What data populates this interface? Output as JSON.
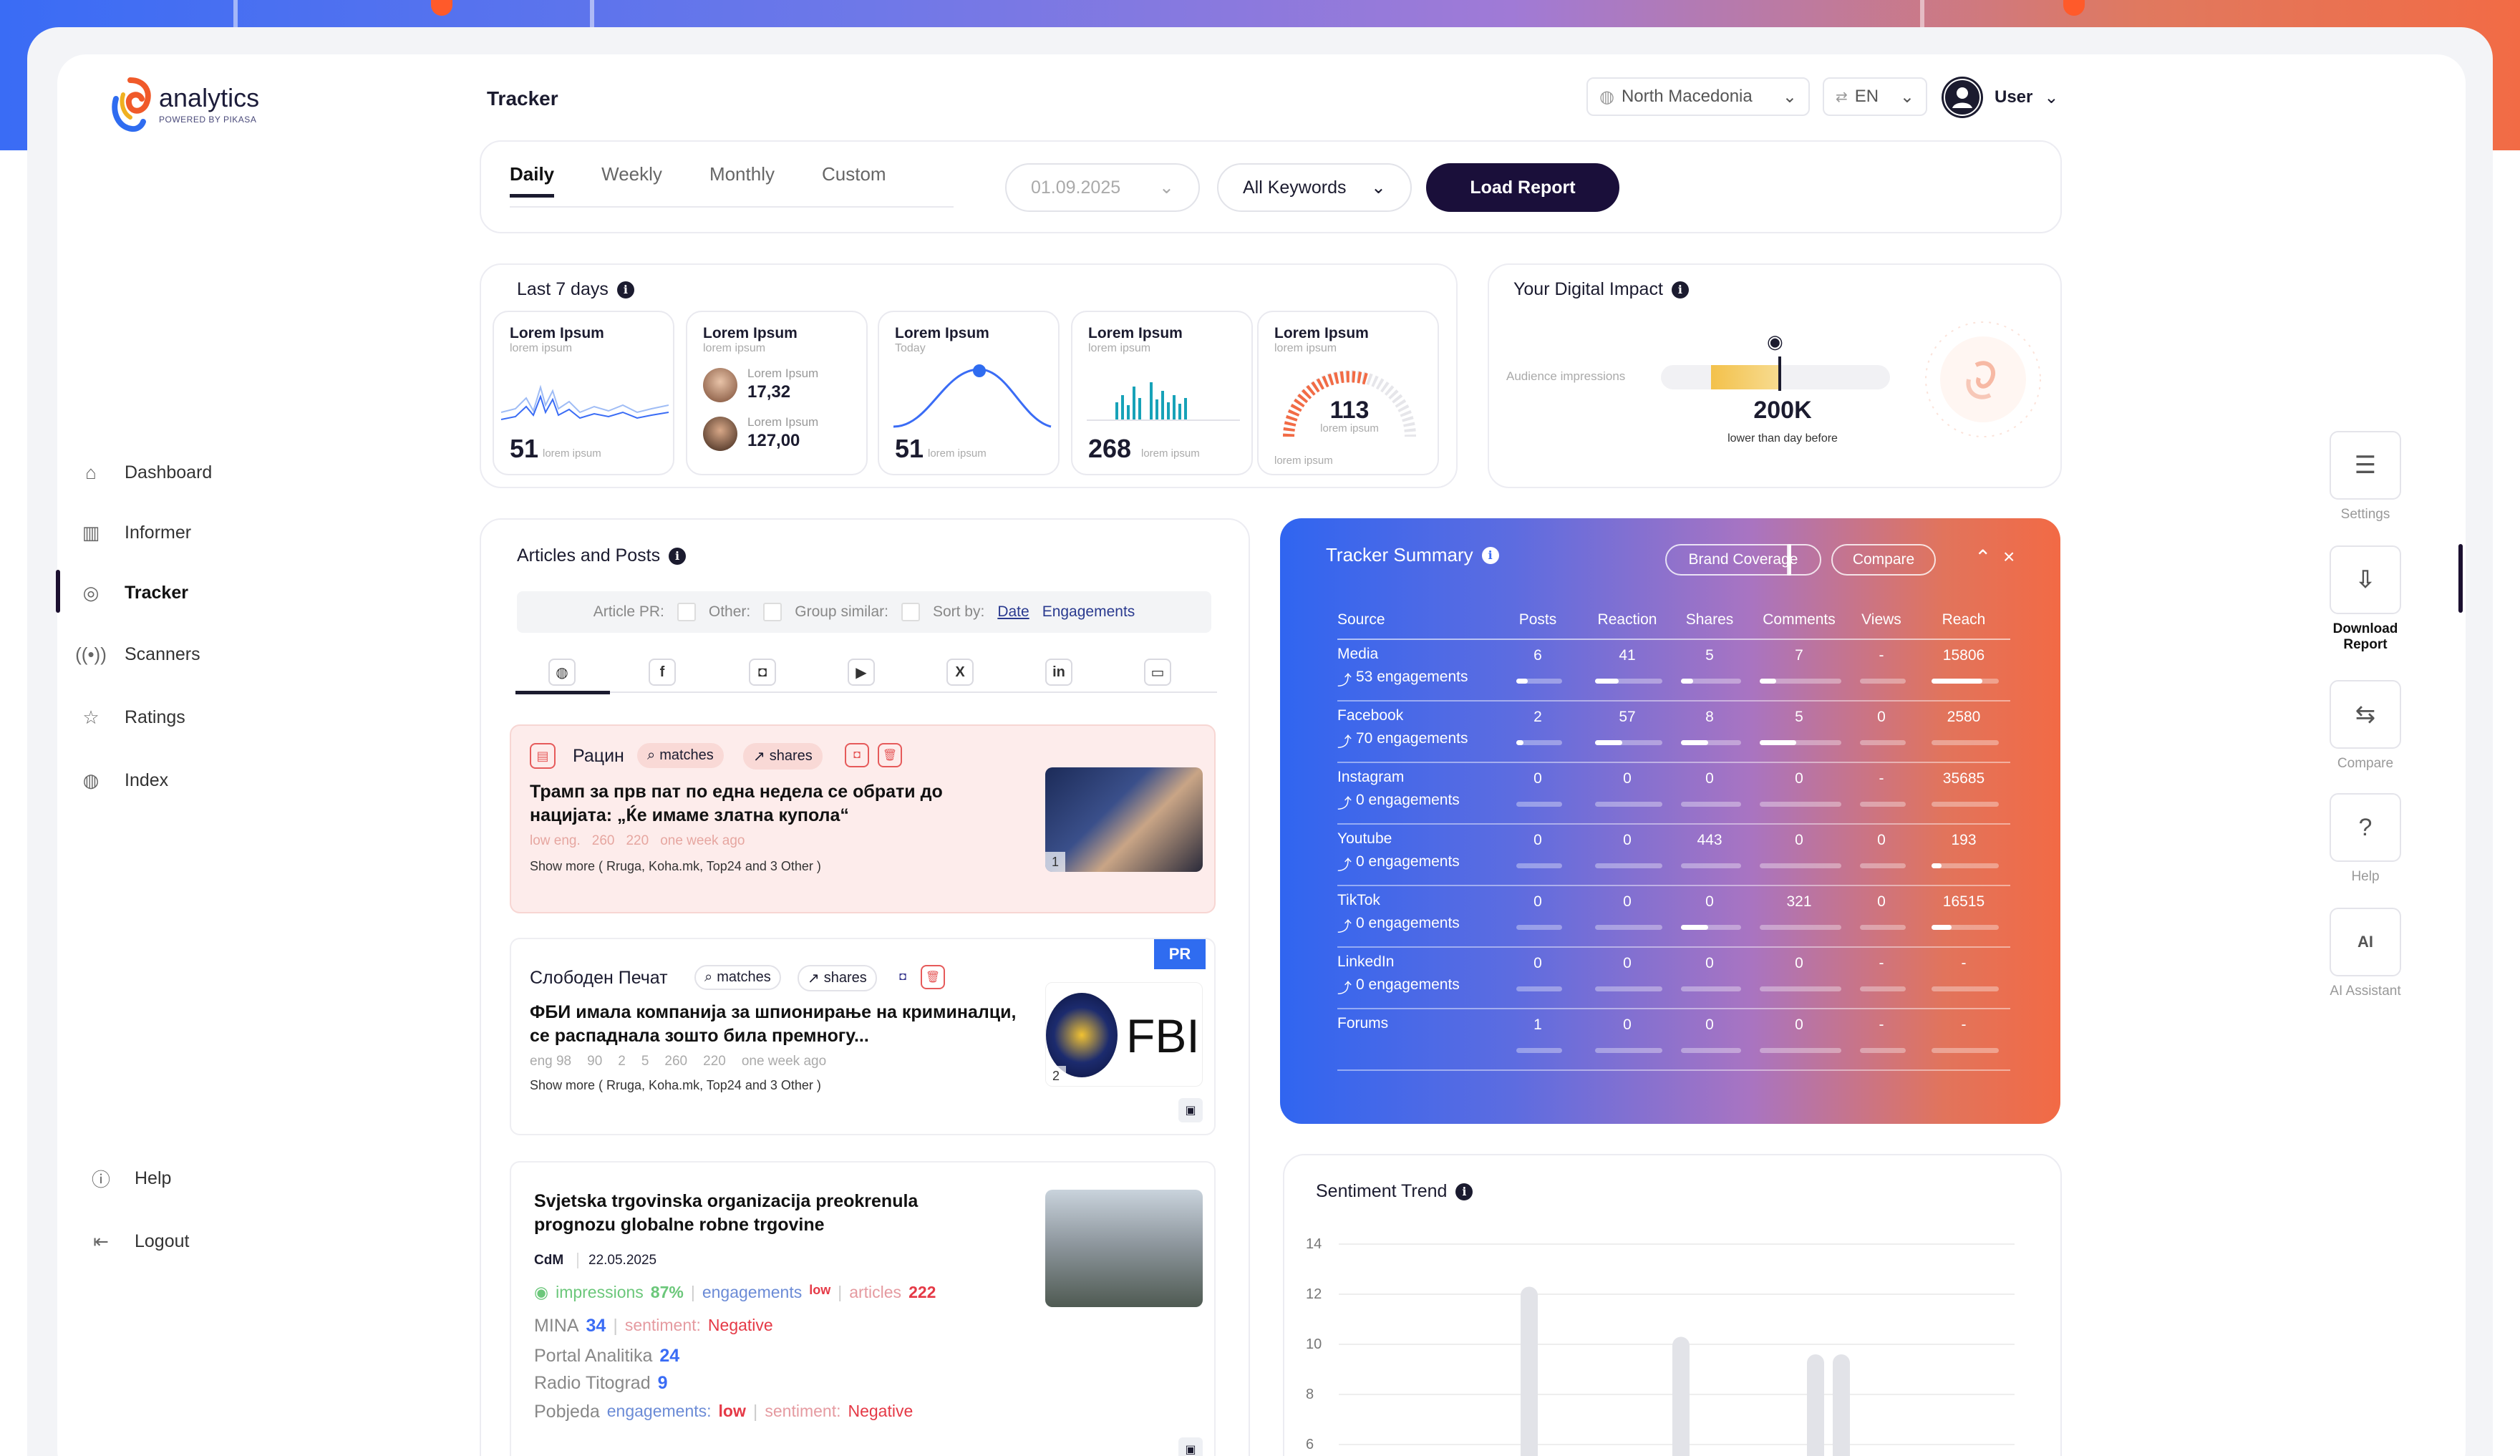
{
  "brand": {
    "name": "analytics",
    "powered_by": "POWERED BY PIKASA"
  },
  "page_title": "Tracker",
  "header": {
    "country": "North Macedonia",
    "language": "EN",
    "user": "User"
  },
  "sidebar": {
    "items": [
      {
        "label": "Dashboard",
        "icon": "home-icon"
      },
      {
        "label": "Informer",
        "icon": "bars-icon"
      },
      {
        "label": "Tracker",
        "icon": "fingerprint-icon"
      },
      {
        "label": "Scanners",
        "icon": "radar-icon"
      },
      {
        "label": "Ratings",
        "icon": "star-icon"
      },
      {
        "label": "Index",
        "icon": "globe-icon"
      }
    ],
    "help": "Help",
    "logout": "Logout"
  },
  "filters": {
    "tabs": [
      "Daily",
      "Weekly",
      "Monthly",
      "Custom"
    ],
    "date": "01.09.2025",
    "keywords": "All Keywords",
    "load_button": "Load Report"
  },
  "last7": {
    "title": "Last 7 days",
    "cards": [
      {
        "title": "Lorem Ipsum",
        "sub": "lorem ipsum",
        "value": "51",
        "value_sub": "lorem ipsum"
      },
      {
        "title": "Lorem Ipsum",
        "sub": "lorem ipsum",
        "person1_label": "Lorem Ipsum",
        "person1_value": "17,32",
        "person2_label": "Lorem Ipsum",
        "person2_value": "127,00"
      },
      {
        "title": "Lorem Ipsum",
        "sub": "Today",
        "value": "51",
        "value_sub": "lorem ipsum"
      },
      {
        "title": "Lorem Ipsum",
        "sub": "lorem ipsum",
        "value": "268",
        "value_sub": "lorem ipsum"
      },
      {
        "title": "Lorem Ipsum",
        "sub": "lorem ipsum",
        "gauge_value": "113",
        "gauge_sub": "lorem ipsum",
        "value_sub": "lorem ipsum"
      }
    ]
  },
  "impact": {
    "title": "Your Digital Impact",
    "label": "Audience impressions",
    "value": "200K",
    "note": "lower than day before"
  },
  "articles": {
    "title": "Articles and Posts",
    "filter": {
      "article_pr": "Article PR:",
      "other": "Other:",
      "group_similar": "Group similar:",
      "sort_by": "Sort by:",
      "sort_date": "Date",
      "sort_eng": "Engagements"
    },
    "social": [
      "globe-icon",
      "facebook-icon",
      "instagram-icon",
      "youtube-icon",
      "x-icon",
      "linkedin-icon",
      "comment-icon"
    ],
    "items": [
      {
        "source": "Рацин",
        "matches": "matches",
        "shares": "shares",
        "title": "Трамп за прв пат по една недела се обрати до нацијата: „Ќе имаме златна купола“",
        "eng": "low eng.",
        "e1": "260",
        "e2": "220",
        "time": "one week ago",
        "show_more": "Show more ( Rruga, Koha.mk, Top24 and 3 Other )",
        "count": "1"
      },
      {
        "source": "Слободен Печат",
        "matches": "matches",
        "shares": "shares",
        "badge": "PR",
        "title": "ФБИ имала компанија за шпионирање на криминалци, се распаднала зошто била премногу...",
        "eng": "eng 98",
        "likes": "90",
        "comments": "2",
        "reshares": "5",
        "e1": "260",
        "e2": "220",
        "time": "one week ago",
        "show_more": "Show more ( Rruga, Koha.mk, Top24 and 3 Other )",
        "count": "2",
        "thumb_text": "FBI"
      },
      {
        "title": "Svjetska trgovinska organizacija preokrenula prognozu globalne robne trgovine",
        "source": "CdM",
        "date": "22.05.2025",
        "impressions": "impressions",
        "impressions_val": "87%",
        "engagements": "engagements",
        "engagements_val": "low",
        "articles": "articles",
        "articles_val": "222",
        "outlets": [
          {
            "name": "MINA",
            "val": "34",
            "sent_label": "sentiment:",
            "sent": "Negative"
          },
          {
            "name": "Portal Analitika",
            "val": "24"
          },
          {
            "name": "Radio Titograd",
            "val": "9"
          },
          {
            "name": "Pobjeda",
            "eng_label": "engagements:",
            "eng": "low",
            "sent_label": "sentiment:",
            "sent": "Negative"
          }
        ]
      }
    ]
  },
  "summary": {
    "title": "Tracker Summary",
    "brand_coverage": "Brand Coverage",
    "compare": "Compare",
    "columns": [
      "Source",
      "Posts",
      "Reaction",
      "Shares",
      "Comments",
      "Views",
      "Reach"
    ],
    "rows": [
      {
        "source": "Media",
        "eng": "53 engagements",
        "values": [
          "6",
          "41",
          "5",
          "7",
          "-",
          "15806"
        ],
        "fills": [
          0.25,
          0.35,
          0.2,
          0.2,
          0,
          0.75
        ]
      },
      {
        "source": "Facebook",
        "eng": "70 engagements",
        "values": [
          "2",
          "57",
          "8",
          "5",
          "0",
          "2580"
        ],
        "fills": [
          0.15,
          0.4,
          0.45,
          0.45,
          0,
          0.0
        ]
      },
      {
        "source": "Instagram",
        "eng": "0 engagements",
        "values": [
          "0",
          "0",
          "0",
          "0",
          "-",
          "35685"
        ],
        "fills": [
          0,
          0,
          0,
          0,
          0,
          0
        ]
      },
      {
        "source": "Youtube",
        "eng": "0 engagements",
        "values": [
          "0",
          "0",
          "443",
          "0",
          "0",
          "193"
        ],
        "fills": [
          0,
          0,
          0,
          0,
          0,
          0.15
        ]
      },
      {
        "source": "TikTok",
        "eng": "0 engagements",
        "values": [
          "0",
          "0",
          "0",
          "321",
          "0",
          "16515"
        ],
        "fills": [
          0,
          0,
          0.45,
          0,
          0,
          0.3
        ]
      },
      {
        "source": "LinkedIn",
        "eng": "0 engagements",
        "values": [
          "0",
          "0",
          "0",
          "0",
          "-",
          "-"
        ],
        "fills": [
          0,
          0,
          0,
          0,
          0,
          0
        ]
      },
      {
        "source": "Forums",
        "eng": "",
        "values": [
          "1",
          "0",
          "0",
          "0",
          "-",
          "-"
        ],
        "fills": [
          0,
          0,
          0,
          0,
          0,
          0
        ]
      }
    ]
  },
  "sentiment": {
    "title": "Sentiment Trend"
  },
  "chart_data": {
    "type": "bar",
    "title": "Sentiment Trend",
    "y_ticks": [
      "14",
      "12",
      "10",
      "8",
      "6"
    ],
    "ylim": [
      6,
      14
    ],
    "bars_top": [
      12.3,
      10.3,
      9.6,
      9.6
    ],
    "grid": true
  },
  "rail": {
    "items": [
      {
        "label": "Settings",
        "icon": "sliders-icon"
      },
      {
        "label": "Download Report",
        "icon": "download-file-icon"
      },
      {
        "label": "Compare",
        "icon": "compare-icon"
      },
      {
        "label": "Help",
        "icon": "help-icon"
      },
      {
        "label": "AI Assistant",
        "icon": "ai-icon"
      }
    ]
  }
}
